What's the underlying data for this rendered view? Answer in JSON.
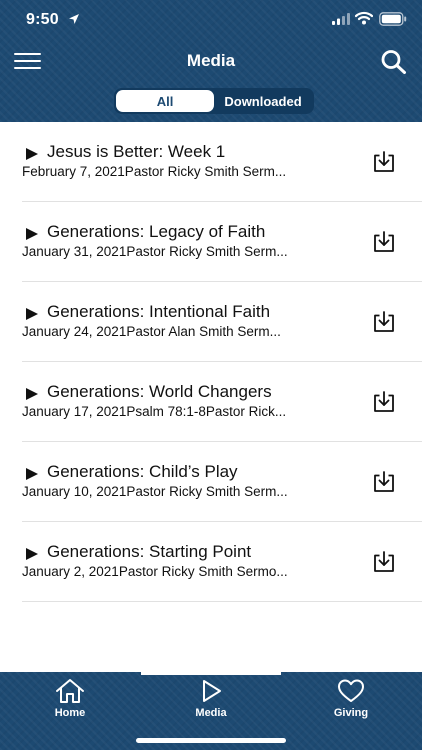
{
  "status_bar": {
    "time": "9:50"
  },
  "header": {
    "title": "Media"
  },
  "segments": {
    "all": "All",
    "downloaded": "Downloaded",
    "selected": "All"
  },
  "items": [
    {
      "title": "Jesus is Better: Week 1",
      "subtitle": "February 7, 2021Pastor Ricky Smith Serm..."
    },
    {
      "title": "Generations: Legacy of Faith",
      "subtitle": "January 31, 2021Pastor Ricky Smith Serm..."
    },
    {
      "title": "Generations: Intentional Faith",
      "subtitle": "January 24, 2021Pastor Alan Smith Serm..."
    },
    {
      "title": "Generations: World Changers",
      "subtitle": "January 17, 2021Psalm 78:1-8Pastor Rick..."
    },
    {
      "title": "Generations: Child’s Play",
      "subtitle": "January 10, 2021Pastor Ricky Smith Serm..."
    },
    {
      "title": "Generations: Starting Point",
      "subtitle": "January 2, 2021Pastor Ricky Smith Sermo..."
    }
  ],
  "tabbar": {
    "home": "Home",
    "media": "Media",
    "giving": "Giving",
    "active": "Media"
  },
  "colors": {
    "brand": "#1d4a72",
    "background": "#ffffff",
    "text": "#111111"
  },
  "icons": {
    "menu": "hamburger-icon",
    "search": "search-icon",
    "play": "play-icon",
    "download": "download-icon",
    "home": "home-icon",
    "media": "play-outline-icon",
    "giving": "heart-icon"
  }
}
